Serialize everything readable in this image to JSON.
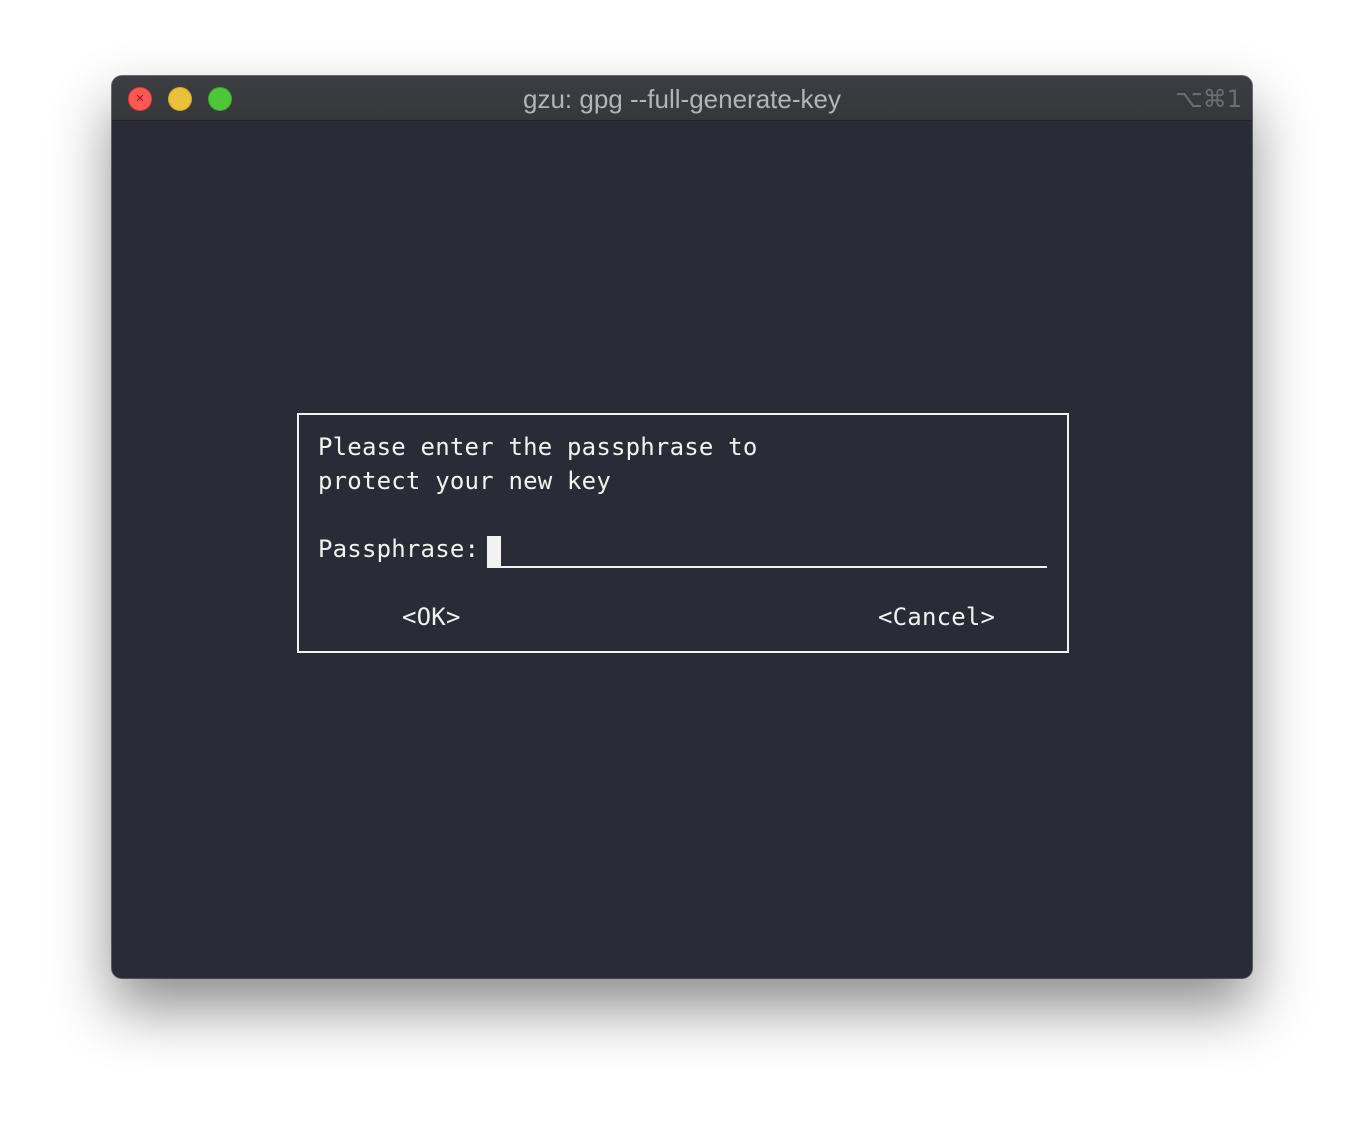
{
  "window": {
    "title": "gzu: gpg --full-generate-key",
    "shortcut": "⌥⌘1",
    "controls": {
      "close": "close-button",
      "minimize": "minimize-button",
      "maximize": "maximize-button"
    }
  },
  "dialog": {
    "message_line1": "Please enter the passphrase to",
    "message_line2": "protect your new key",
    "passphrase_label": "Passphrase:",
    "passphrase_value": "",
    "ok_label": "<OK>",
    "cancel_label": "<Cancel>"
  },
  "colors": {
    "terminal_bg": "#292b36",
    "titlebar_bg": "#3a3b40",
    "text": "#f2f2f2",
    "close": "#fc5753",
    "minimize": "#e8c03b",
    "maximize": "#4fc53a"
  }
}
